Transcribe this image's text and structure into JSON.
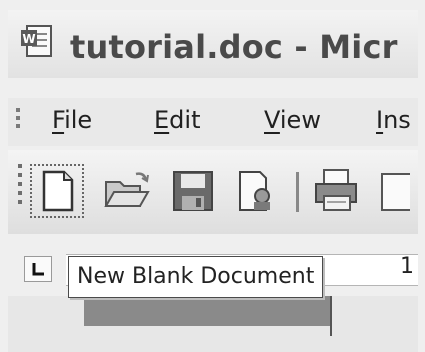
{
  "window": {
    "title": "tutorial.doc - Micr",
    "app_icon": "word-document-icon"
  },
  "menu": {
    "items": [
      {
        "key": "F",
        "rest": "ile"
      },
      {
        "key": "E",
        "rest": "dit"
      },
      {
        "key": "V",
        "rest": "iew"
      },
      {
        "key": "I",
        "rest": "ns"
      }
    ]
  },
  "toolbar": {
    "buttons": [
      {
        "icon": "new-blank-document-icon",
        "selected": true
      },
      {
        "icon": "open-folder-icon"
      },
      {
        "icon": "save-disk-icon"
      },
      {
        "icon": "permission-icon"
      },
      {
        "icon": "print-icon"
      }
    ]
  },
  "tooltip": {
    "text": "New Blank Document"
  },
  "ruler": {
    "tab_stop_glyph": "L",
    "visible_number": "1"
  }
}
